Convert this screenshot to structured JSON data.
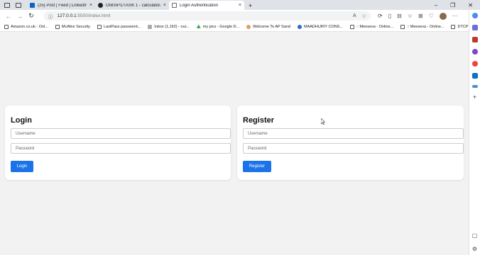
{
  "browser": {
    "tabs": [
      {
        "label": "(25) Post | Feed | LinkedIn",
        "icon": "linkedin-icon"
      },
      {
        "label": "OIBSIP1/TASK 1 - calculator/inde",
        "icon": "github-icon"
      },
      {
        "label": "Login Authentication",
        "icon": "page-icon",
        "active": true
      }
    ],
    "address": {
      "host": "127.0.0.1",
      "path": ":5500/index.html"
    },
    "bookmarks": [
      "Amazon.co.uk - Onl...",
      "McAfee Security",
      "LastPass password...",
      "Inbox (1,162) - nur...",
      "my pics - Google D...",
      "Welcome To AP Sand",
      "MAADHURIY CONS...",
      ":: Meeseva - Online...",
      ":: Meeseva - Online...",
      "DTCP"
    ]
  },
  "login": {
    "title": "Login",
    "username_placeholder": "Username",
    "password_placeholder": "Password",
    "button": "Login"
  },
  "register": {
    "title": "Register",
    "username_placeholder": "Username",
    "password_placeholder": "Password",
    "button": "Register"
  },
  "colors": {
    "accent": "#1a73e8",
    "page_bg": "#f2f2f2",
    "card_bg": "#ffffff"
  }
}
